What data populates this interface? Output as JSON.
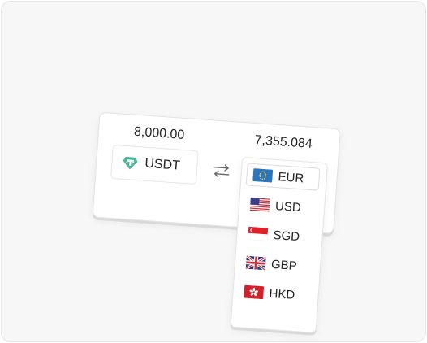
{
  "converter": {
    "from_amount": "8,000.00",
    "to_amount": "7,355.084",
    "from_currency": "USDT",
    "selected_currency": "EUR",
    "options": [
      "USD",
      "SGD",
      "GBP",
      "HKD"
    ]
  },
  "icons": {
    "token": "tether-icon",
    "swap": "swap-arrows-icon",
    "flags": [
      "eu-flag-icon",
      "us-flag-icon",
      "sg-flag-icon",
      "uk-flag-icon",
      "hk-flag-icon"
    ]
  },
  "colors": {
    "tether": "#48b89a",
    "eu_blue": "#2a74c0",
    "us_red": "#c8323c",
    "sg_red": "#e2202a",
    "uk_blue": "#1f3a7a",
    "hk_red": "#d4202a"
  }
}
